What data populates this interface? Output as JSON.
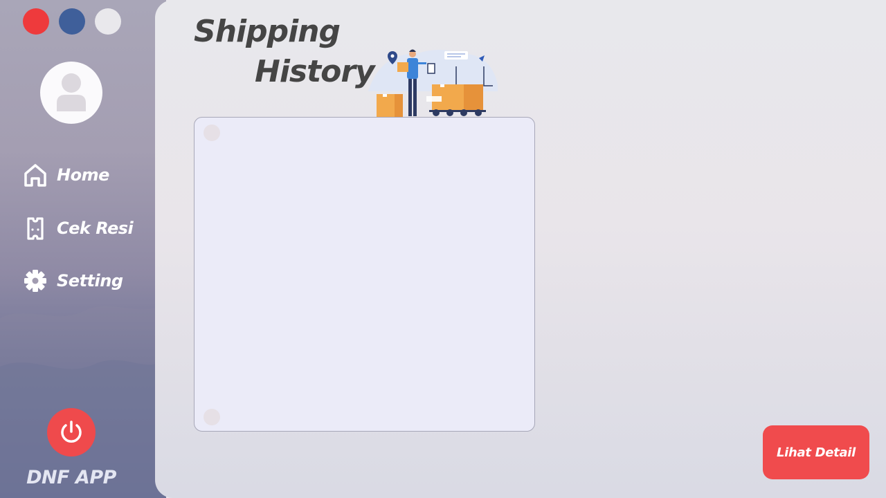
{
  "window_controls": {
    "close": {
      "icon": "close-dot",
      "color": "#ee3a3c"
    },
    "minimize": {
      "icon": "minimize-dot",
      "color": "#3f5f9a"
    },
    "maximize": {
      "icon": "maximize-dot",
      "color": "#e9e8ec"
    }
  },
  "sidebar": {
    "avatar": {
      "icon": "user-icon"
    },
    "items": [
      {
        "label": "Home",
        "icon": "home-icon"
      },
      {
        "label": "Cek Resi",
        "icon": "receipt-icon"
      },
      {
        "label": "Setting",
        "icon": "gear-icon"
      }
    ],
    "power": {
      "icon": "power-icon",
      "color": "#ef4a4c"
    },
    "app_name": "DNF APP"
  },
  "main": {
    "title_line1": "Shipping",
    "title_line2": "History",
    "illustration": "shipping-illustration",
    "detail_button_label": "Lihat Detail",
    "accent_color": "#f04b4d"
  }
}
